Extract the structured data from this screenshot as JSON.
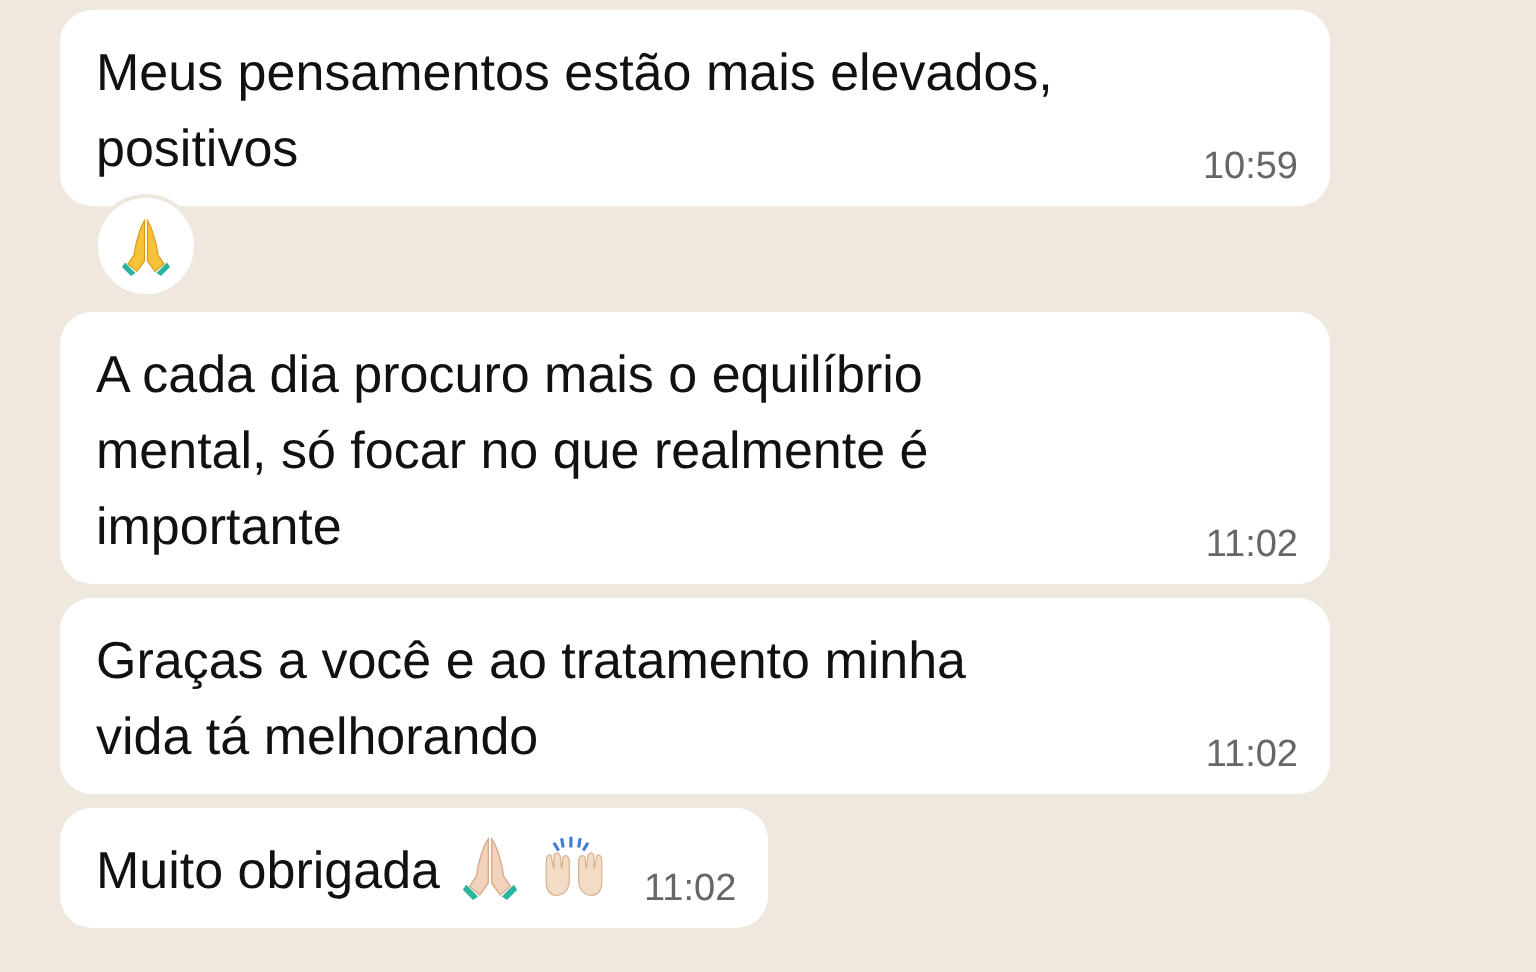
{
  "messages": [
    {
      "kind": "text",
      "text": "Meus pensamentos estão mais elevados,\npositivos",
      "time": "10:59",
      "reaction": true
    },
    {
      "kind": "text",
      "text": "A cada dia procuro mais o equilíbrio\nmental, só focar no que realmente é\nimportante",
      "time": "11:02",
      "reaction": false
    },
    {
      "kind": "text",
      "text": "Graças a você e ao tratamento minha\nvida tá melhorando",
      "time": "11:02",
      "reaction": false
    },
    {
      "kind": "text-with-emoji",
      "text": "Muito obrigada",
      "time": "11:02",
      "reaction": false
    }
  ]
}
